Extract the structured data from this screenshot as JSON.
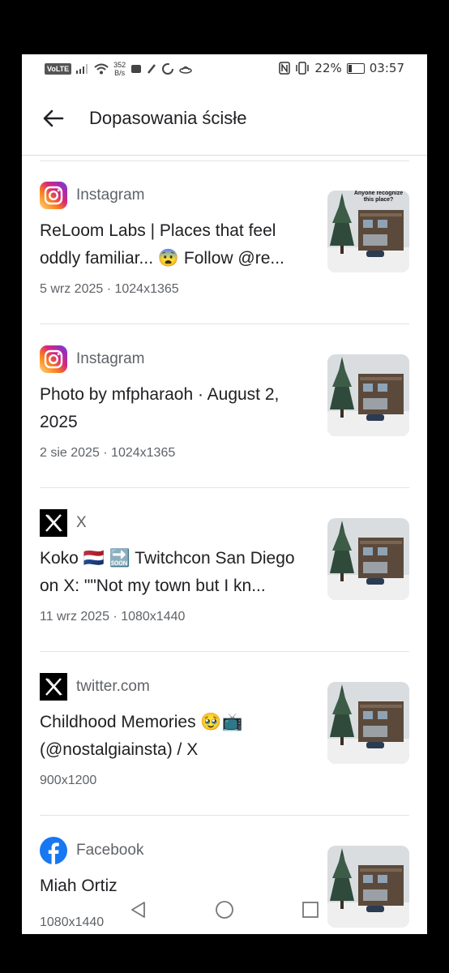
{
  "status_bar": {
    "volte": "VoLTE",
    "net_speed_value": "352",
    "net_speed_unit": "B/s",
    "battery": "22%",
    "battery_level": 0.22,
    "time": "03:57"
  },
  "header": {
    "title": "Dopasowania ścisłe"
  },
  "thumbnail_caption": "Anyone recognize this place?",
  "results": [
    {
      "source": "Instagram",
      "icon": "instagram-icon",
      "title": "ReLoom Labs | Places that feel oddly familiar... 😨 Follow @re...",
      "meta": "5 wrz 2025 · 1024x1365"
    },
    {
      "source": "Instagram",
      "icon": "instagram-icon",
      "title": "Photo by mfpharaoh · August 2, 2025",
      "meta": "2 sie 2025 · 1024x1365"
    },
    {
      "source": "X",
      "icon": "x-icon",
      "title": "Koko 🇳🇱 🔜 Twitchcon San Diego on X: \"\"Not my town but I kn...",
      "meta": "11 wrz 2025 · 1080x1440"
    },
    {
      "source": "twitter.com",
      "icon": "x-icon",
      "title": "Childhood Memories 🥹📺 (@nostalgiainsta) / X",
      "meta": "900x1200"
    },
    {
      "source": "Facebook",
      "icon": "facebook-icon",
      "title": "Miah Ortiz",
      "meta": "1080x1440"
    }
  ],
  "colors": {
    "facebook": "#1877f2",
    "x": "#000000",
    "text_primary": "#202124",
    "text_secondary": "#5f6368"
  }
}
